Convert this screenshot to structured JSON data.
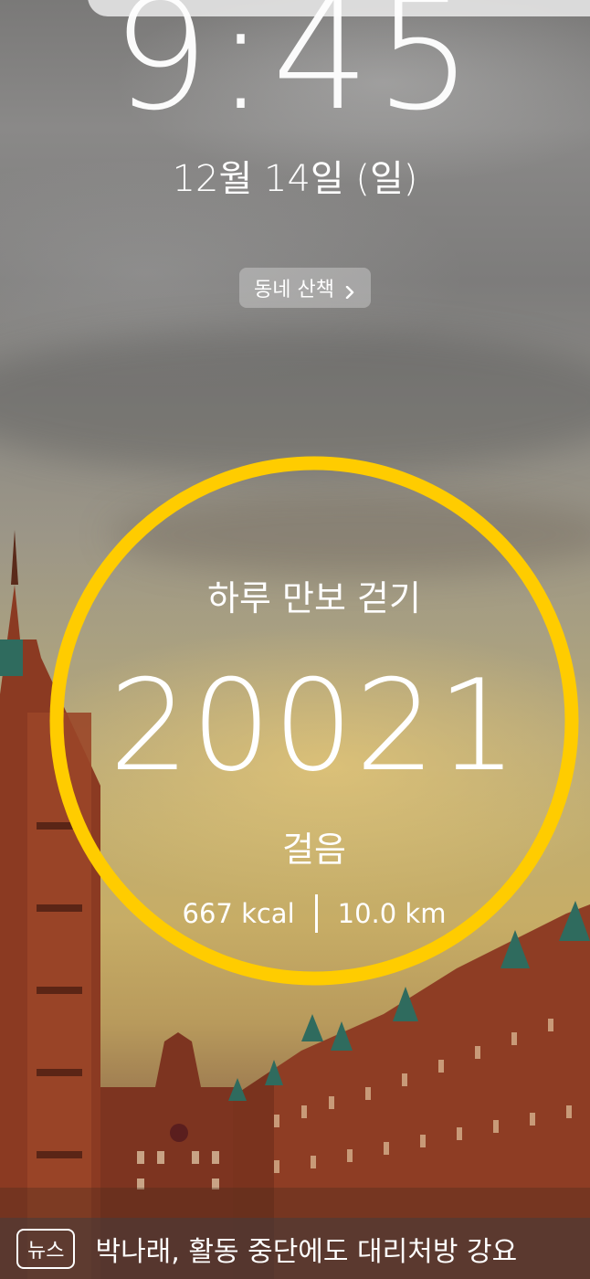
{
  "lockscreen": {
    "time": "9:45",
    "date": "12월 14일 (일)",
    "chip_label": "동네 산책",
    "chip_icon": "chevron-right-icon"
  },
  "steps_widget": {
    "title": "하루 만보 걷기",
    "count": "20021",
    "unit": "걸음",
    "calories": "667 kcal",
    "distance": "10.0 km",
    "ring_color": "#FFCC00"
  },
  "news": {
    "tag": "뉴스",
    "headline": "박나래, 활동 중단에도 대리처방 강요"
  }
}
